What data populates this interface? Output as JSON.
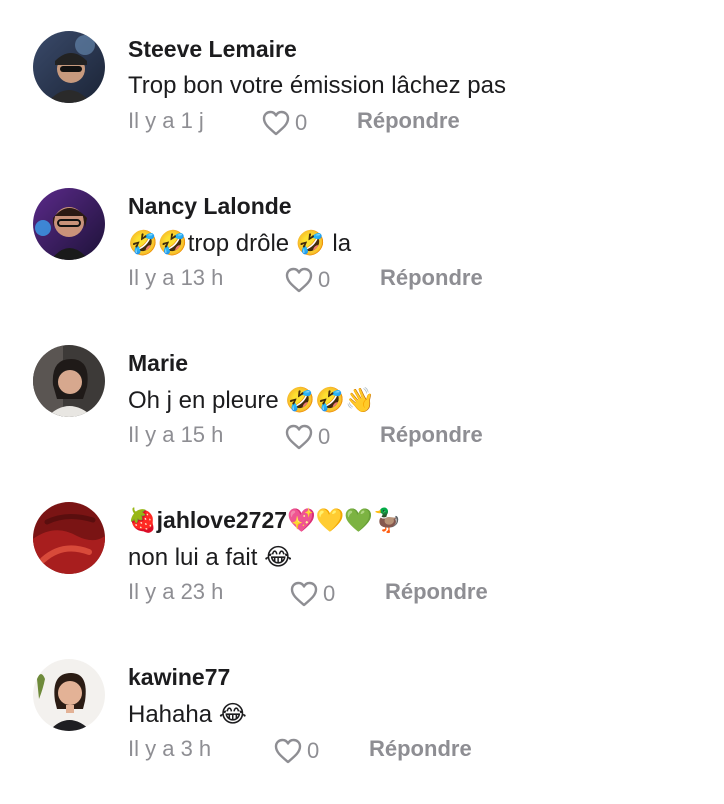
{
  "comments": [
    {
      "username": "Steeve Lemaire",
      "text": "Trop bon votre émission lâchez pas",
      "time": "Il y a 1 j",
      "likes": "0",
      "reply": "Répondre"
    },
    {
      "username": "Nancy Lalonde",
      "text": "🤣🤣trop drôle 🤣 la",
      "time": "Il y a 13 h",
      "likes": "0",
      "reply": "Répondre"
    },
    {
      "username": "Marie",
      "text": "Oh j en pleure 🤣🤣👋",
      "time": "Il y a 15 h",
      "likes": "0",
      "reply": "Répondre"
    },
    {
      "username": "🍓jahlove2727💖💛💚🦆",
      "text": "non lui a fait 😂",
      "time": "Il y a 23 h",
      "likes": "0",
      "reply": "Répondre"
    },
    {
      "username": "kawine77",
      "text": "Hahaha 😂",
      "time": "Il y a 3 h",
      "likes": "0",
      "reply": "Répondre"
    }
  ]
}
